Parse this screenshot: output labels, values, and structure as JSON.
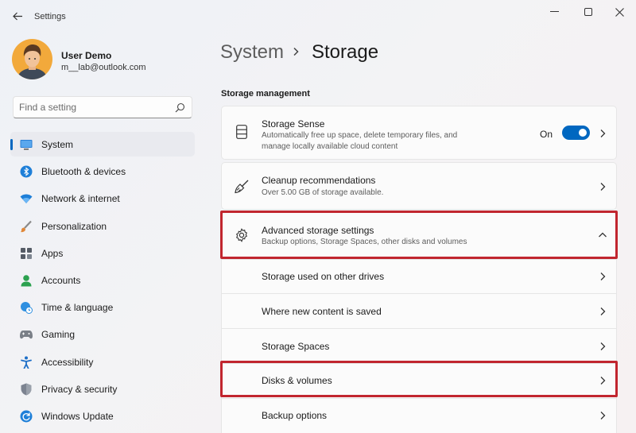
{
  "window": {
    "title": "Settings"
  },
  "user": {
    "name": "User Demo",
    "email": "m__lab@outlook.com"
  },
  "search": {
    "placeholder": "Find a setting",
    "value": ""
  },
  "sidebar": {
    "items": [
      {
        "label": "System",
        "icon": "monitor-icon",
        "active": true
      },
      {
        "label": "Bluetooth & devices",
        "icon": "bluetooth-icon"
      },
      {
        "label": "Network & internet",
        "icon": "wifi-icon"
      },
      {
        "label": "Personalization",
        "icon": "brush-icon"
      },
      {
        "label": "Apps",
        "icon": "apps-icon"
      },
      {
        "label": "Accounts",
        "icon": "person-icon"
      },
      {
        "label": "Time & language",
        "icon": "globe-clock-icon"
      },
      {
        "label": "Gaming",
        "icon": "gamepad-icon"
      },
      {
        "label": "Accessibility",
        "icon": "accessibility-icon"
      },
      {
        "label": "Privacy & security",
        "icon": "shield-icon"
      },
      {
        "label": "Windows Update",
        "icon": "update-icon"
      }
    ]
  },
  "breadcrumb": {
    "parent": "System",
    "current": "Storage"
  },
  "main": {
    "section_title": "Storage management",
    "storage_sense": {
      "title": "Storage Sense",
      "description": "Automatically free up space, delete temporary files, and manage locally available cloud content",
      "toggle_label": "On",
      "toggle_on": true
    },
    "cleanup": {
      "title": "Cleanup recommendations",
      "description": "Over 5.00 GB of storage available."
    },
    "advanced": {
      "title": "Advanced storage settings",
      "description": "Backup options, Storage Spaces, other disks and volumes",
      "expanded": true
    },
    "advanced_items": [
      "Storage used on other drives",
      "Where new content is saved",
      "Storage Spaces",
      "Disks & volumes",
      "Backup options"
    ]
  },
  "colors": {
    "accent": "#0067c0",
    "highlight": "#c1262f"
  }
}
